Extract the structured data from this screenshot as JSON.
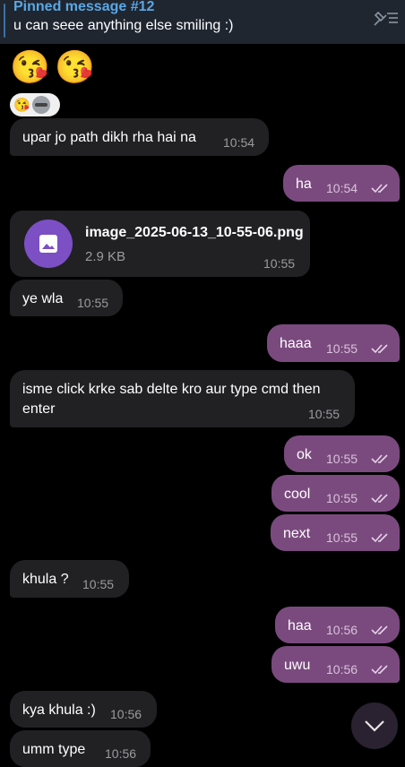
{
  "pinned": {
    "title": "Pinned message #12",
    "text": "u can seee anything else smiling :)"
  },
  "emojis": [
    "😘",
    "😘"
  ],
  "reaction": "😘",
  "messages": [
    {
      "dir": "in",
      "text": "upar jo path dikh rha hai na",
      "time": "10:54"
    },
    {
      "dir": "out",
      "text": "ha",
      "time": "10:54"
    },
    {
      "dir": "in",
      "file_name": "image_2025-06-13_10-55-06.png",
      "file_size": "2.9 KB",
      "time": "10:55"
    },
    {
      "dir": "in",
      "text": "ye wla",
      "time": "10:55"
    },
    {
      "dir": "out",
      "text": "haaa",
      "time": "10:55"
    },
    {
      "dir": "in",
      "text_line1": "isme click krke sab delte kro aur type cmd then",
      "text_line2": "enter",
      "time": "10:55"
    },
    {
      "dir": "out",
      "text": "ok",
      "time": "10:55"
    },
    {
      "dir": "out",
      "text": "cool",
      "time": "10:55"
    },
    {
      "dir": "out",
      "text": "next",
      "time": "10:55"
    },
    {
      "dir": "in",
      "text": "khula ?",
      "time": "10:55"
    },
    {
      "dir": "out",
      "text": "haa",
      "time": "10:56"
    },
    {
      "dir": "out",
      "text": "uwu",
      "time": "10:56"
    },
    {
      "dir": "in",
      "text": "kya khula :)",
      "time": "10:56"
    },
    {
      "dir": "in",
      "text": "umm type",
      "time": "10:56"
    }
  ]
}
